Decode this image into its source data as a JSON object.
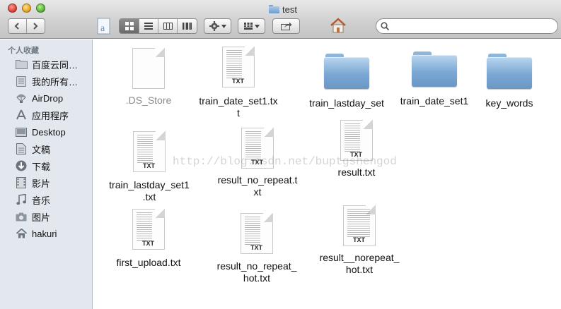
{
  "window": {
    "title": "test"
  },
  "toolbar": {
    "back_icon": "chevron-left-icon",
    "forward_icon": "chevron-right-icon",
    "view_modes": [
      "icon-view",
      "list-view",
      "column-view",
      "coverflow-view"
    ],
    "active_view": "icon-view",
    "action_icon": "gear-icon",
    "arrange_icon": "grid-icon",
    "share_icon": "share-icon",
    "home_icon": "home-icon",
    "search_placeholder": ""
  },
  "sidebar": {
    "header": "个人收藏",
    "items": [
      {
        "label": "百度云同…",
        "icon": "folder-icon"
      },
      {
        "label": "我的所有…",
        "icon": "all-files-icon"
      },
      {
        "label": "AirDrop",
        "icon": "airdrop-icon"
      },
      {
        "label": "应用程序",
        "icon": "applications-icon"
      },
      {
        "label": "Desktop",
        "icon": "desktop-icon"
      },
      {
        "label": "文稿",
        "icon": "documents-icon"
      },
      {
        "label": "下载",
        "icon": "downloads-icon"
      },
      {
        "label": "影片",
        "icon": "movies-icon"
      },
      {
        "label": "音乐",
        "icon": "music-icon"
      },
      {
        "label": "图片",
        "icon": "pictures-icon"
      },
      {
        "label": "hakuri",
        "icon": "home-icon"
      }
    ]
  },
  "files": [
    {
      "name": ".DS_Store",
      "kind": "blank",
      "dim": true
    },
    {
      "name": "train_date_set1.tx\nt",
      "kind": "txt"
    },
    {
      "name": "train_lastday_set",
      "kind": "folder"
    },
    {
      "name": "train_date_set1",
      "kind": "folder"
    },
    {
      "name": "key_words",
      "kind": "folder"
    },
    {
      "name": "train_lastday_set1\n.txt",
      "kind": "txt"
    },
    {
      "name": "result_no_repeat.t\nxt",
      "kind": "txt"
    },
    {
      "name": "result.txt",
      "kind": "txt"
    },
    {
      "name": "first_upload.txt",
      "kind": "txt"
    },
    {
      "name": "result_no_repeat_\nhot.txt",
      "kind": "txt"
    },
    {
      "name": "result__norepeat_\nhot.txt",
      "kind": "txt"
    }
  ],
  "doc_tag": "TXT",
  "watermark": "http://blog.csdn.net/buptgshengod"
}
